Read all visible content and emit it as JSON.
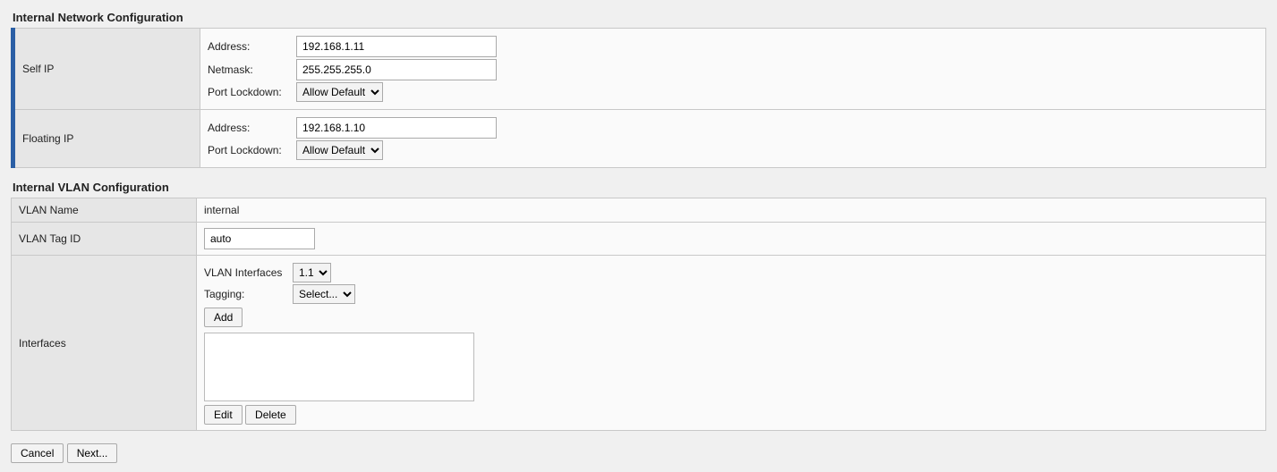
{
  "network": {
    "title": "Internal Network Configuration",
    "self_ip": {
      "rowlabel": "Self IP",
      "address_label": "Address:",
      "address_value": "192.168.1.11",
      "netmask_label": "Netmask:",
      "netmask_value": "255.255.255.0",
      "lockdown_label": "Port Lockdown:",
      "lockdown_value": "Allow Default"
    },
    "floating_ip": {
      "rowlabel": "Floating IP",
      "address_label": "Address:",
      "address_value": "192.168.1.10",
      "lockdown_label": "Port Lockdown:",
      "lockdown_value": "Allow Default"
    }
  },
  "vlan": {
    "title": "Internal VLAN Configuration",
    "name_label": "VLAN Name",
    "name_value": "internal",
    "tagid_label": "VLAN Tag ID",
    "tagid_value": "auto",
    "interfaces": {
      "rowlabel": "Interfaces",
      "vlan_if_label": "VLAN Interfaces",
      "vlan_if_value": "1.1",
      "tagging_label": "Tagging:",
      "tagging_value": "Select...",
      "add_label": "Add",
      "edit_label": "Edit",
      "delete_label": "Delete"
    }
  },
  "footer": {
    "cancel": "Cancel",
    "next": "Next..."
  }
}
